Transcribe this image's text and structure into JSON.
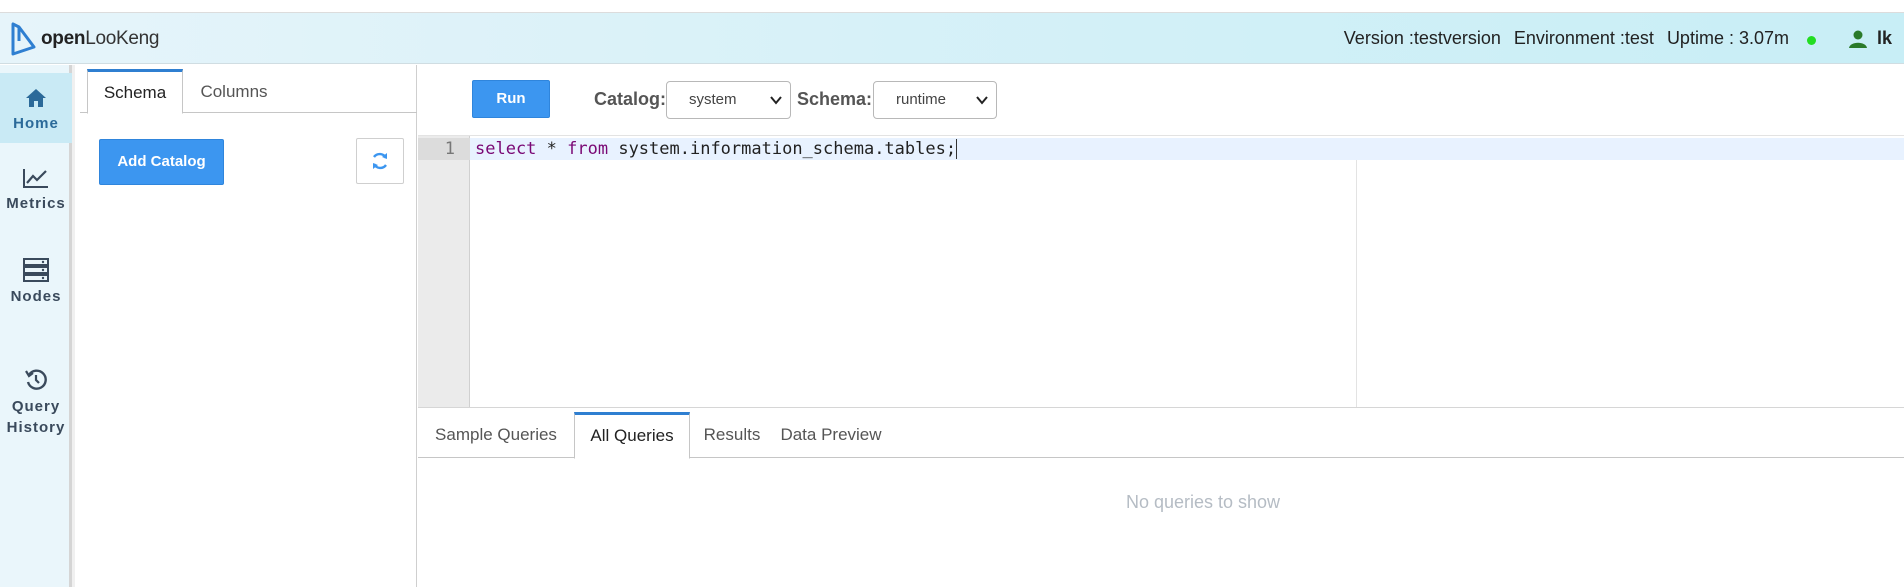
{
  "header": {
    "logo": {
      "prefix": "open",
      "suffix": "LooKeng"
    },
    "version": "Version :testversion",
    "environment": "Environment :test",
    "uptime": "Uptime : 3.07m",
    "status_color": "#22dd22",
    "user": "lk"
  },
  "sidebar": {
    "items": [
      {
        "label": "Home",
        "icon": "home-icon",
        "active": true
      },
      {
        "label": "Metrics",
        "icon": "chart-line-icon",
        "active": false
      },
      {
        "label": "Nodes",
        "icon": "server-icon",
        "active": false
      },
      {
        "label_line1": "Query",
        "label_line2": "History",
        "icon": "history-icon",
        "active": false
      }
    ]
  },
  "schema_panel": {
    "tabs": [
      "Schema",
      "Columns"
    ],
    "active_tab": "Schema",
    "add_catalog_label": "Add Catalog"
  },
  "toolbar": {
    "run_label": "Run",
    "catalog_label": "Catalog:",
    "catalog_value": "system",
    "schema_label": "Schema:",
    "schema_value": "runtime"
  },
  "editor": {
    "line_number": "1",
    "tokens": {
      "select": "select",
      "star": " * ",
      "from": "from",
      "rest": " system.information_schema.tables;"
    }
  },
  "results": {
    "tabs": [
      "Sample Queries",
      "All Queries",
      "Results",
      "Data Preview"
    ],
    "active_tab": "All Queries",
    "empty_message": "No queries to show"
  },
  "colors": {
    "accent": "#3c96f0",
    "tab_border_active": "#2f7fd1",
    "keyword": "#7a0874"
  }
}
